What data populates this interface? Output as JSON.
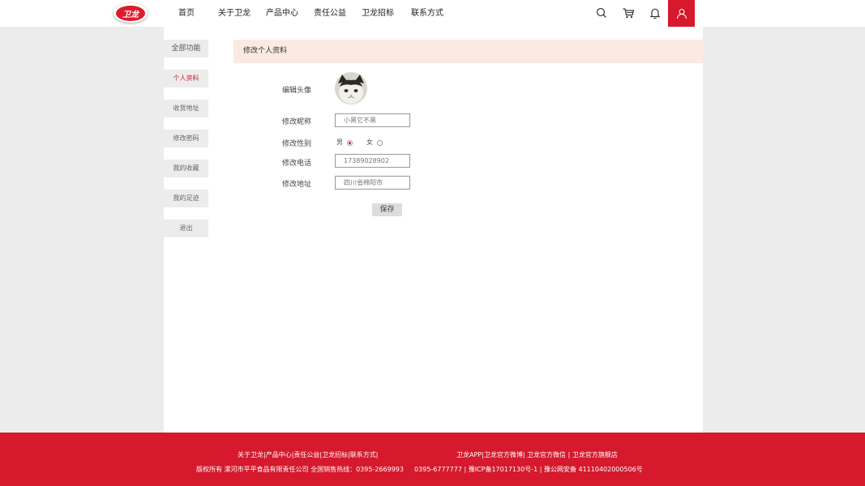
{
  "header": {
    "logo_text": "卫龙",
    "nav": [
      "首页",
      "关于卫龙",
      "产品中心",
      "责任公益",
      "卫龙招标",
      "联系方式"
    ],
    "icons": [
      "search-icon",
      "cart-icon",
      "bell-icon",
      "user-icon"
    ],
    "accent_color": "#d6192c"
  },
  "sidebar": {
    "title": "全部功能",
    "items": [
      {
        "label": "个人资料",
        "active": true
      },
      {
        "label": "收货地址"
      },
      {
        "label": "修改密码"
      },
      {
        "label": "我的收藏"
      },
      {
        "label": "我的足迹"
      },
      {
        "label": "退出"
      }
    ]
  },
  "content": {
    "title": "修改个人资料",
    "avatar_label": "编辑头像",
    "nickname": {
      "label": "修改昵称",
      "value": "小黑它不黑"
    },
    "gender": {
      "label": "修改性别",
      "options": [
        "男",
        "女"
      ],
      "selected": "男"
    },
    "phone": {
      "label": "修改电话",
      "value": "17389028902"
    },
    "address": {
      "label": "修改地址",
      "value": "四川省绵阳市"
    },
    "save_label": "保存"
  },
  "footer": {
    "links": "关于卫龙|产品中心|责任公益|卫龙招标|联系方式|",
    "social": "卫龙APP|卫龙官方微博| 卫龙官方微信 | 卫龙官方旗舰店",
    "copyright": "版权所有 漯河市平平食品有限责任公司 全国销售热线：0395-2669993 　 0395-6777777 | 豫ICP备17017130号-1 | 豫公网安备 41110402000506号"
  }
}
